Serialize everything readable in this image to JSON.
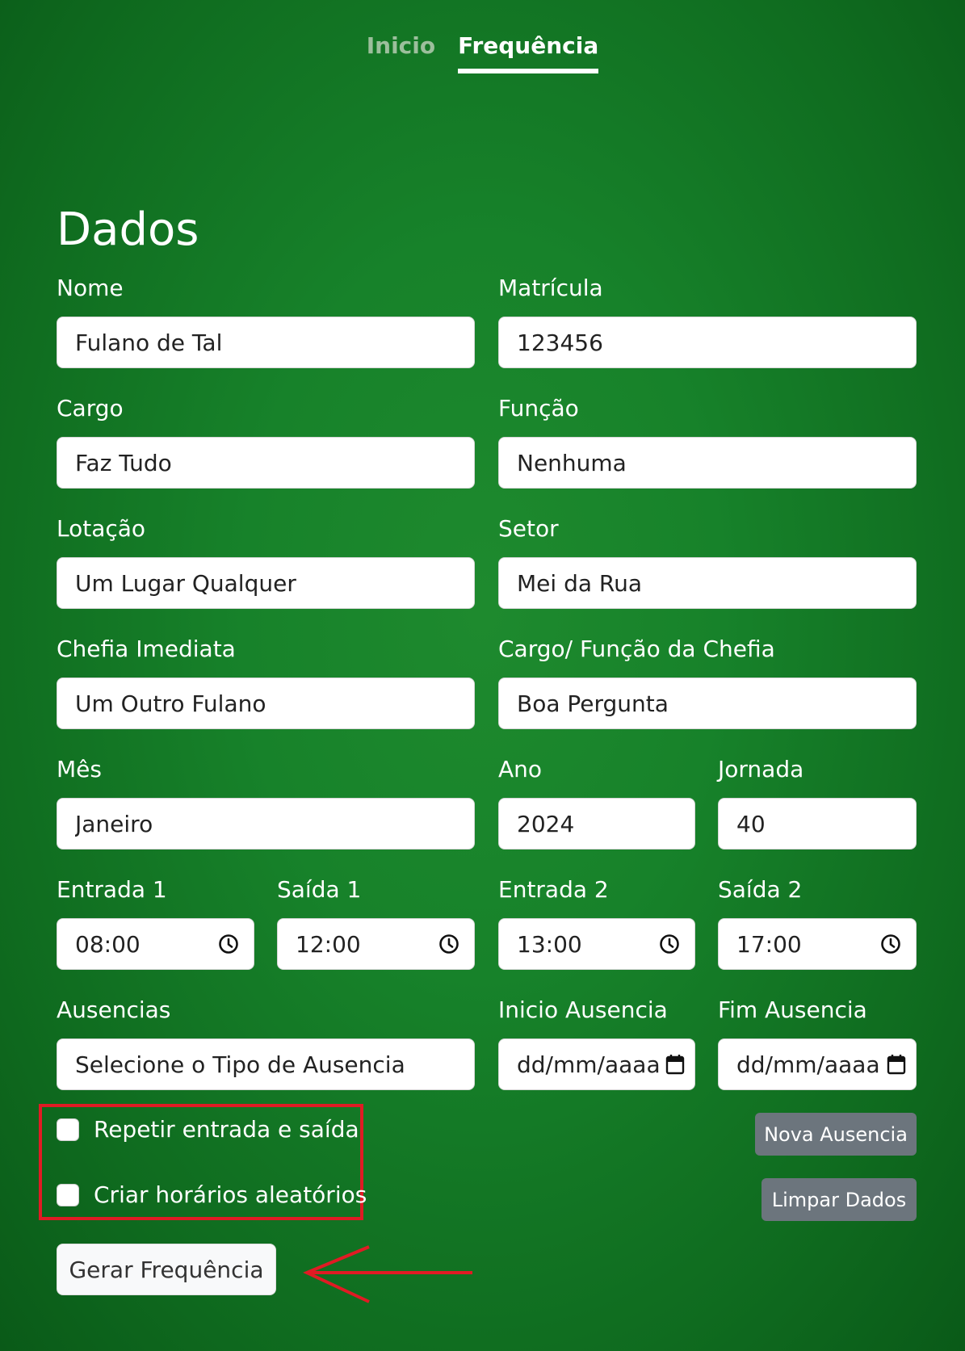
{
  "nav": {
    "tabs": [
      "Inicio",
      "Frequência"
    ],
    "active": "Frequência"
  },
  "form": {
    "title": "Dados",
    "nome": {
      "label": "Nome",
      "value": "Fulano de Tal"
    },
    "matricula": {
      "label": "Matrícula",
      "value": "123456"
    },
    "cargo": {
      "label": "Cargo",
      "value": "Faz Tudo"
    },
    "funcao": {
      "label": "Função",
      "value": "Nenhuma"
    },
    "lotacao": {
      "label": "Lotação",
      "value": "Um Lugar Qualquer"
    },
    "setor": {
      "label": "Setor",
      "value": "Mei da Rua"
    },
    "chefia": {
      "label": "Chefia Imediata",
      "value": "Um Outro Fulano"
    },
    "cargo_chefia": {
      "label": "Cargo/ Função da Chefia",
      "value": "Boa Pergunta"
    },
    "mes": {
      "label": "Mês",
      "value": "Janeiro"
    },
    "ano": {
      "label": "Ano",
      "value": "2024"
    },
    "jornada": {
      "label": "Jornada",
      "value": "40"
    },
    "entrada1": {
      "label": "Entrada 1",
      "value": "08:00"
    },
    "saida1": {
      "label": "Saída 1",
      "value": "12:00"
    },
    "entrada2": {
      "label": "Entrada 2",
      "value": "13:00"
    },
    "saida2": {
      "label": "Saída 2",
      "value": "17:00"
    },
    "ausencias": {
      "label": "Ausencias",
      "value": "Selecione o Tipo de Ausencia"
    },
    "inicio_ausencia": {
      "label": "Inicio Ausencia",
      "placeholder": "dd/mm/aaaa"
    },
    "fim_ausencia": {
      "label": "Fim Ausencia",
      "placeholder": "dd/mm/aaaa"
    },
    "repetir_label": "Repetir entrada e saída",
    "aleatorio_label": "Criar horários aleatórios",
    "nova_ausencia_label": "Nova Ausencia",
    "limpar_label": "Limpar Dados",
    "gerar_label": "Gerar Frequência"
  },
  "colors": {
    "background": "#17822a",
    "annotation": "#e01b24",
    "button_secondary": "#6c757d"
  },
  "icons": {
    "time": "clock-icon",
    "date": "calendar-icon"
  }
}
